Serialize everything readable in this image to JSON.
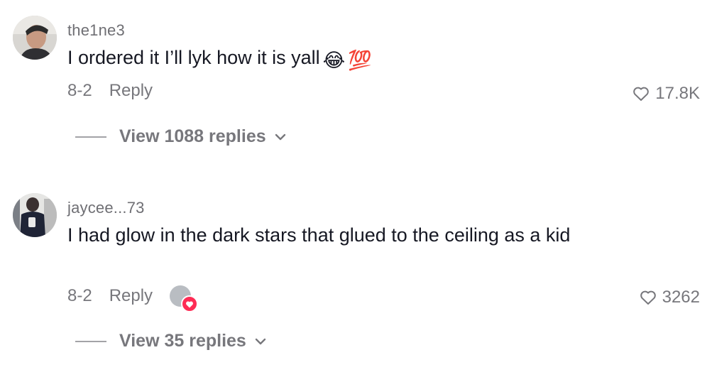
{
  "comments": [
    {
      "username": "the1ne3",
      "text": "I ordered it I’ll lyk how it is yall",
      "emojis": [
        "😂",
        "💯"
      ],
      "date": "8-2",
      "reply_label": "Reply",
      "likes": "17.8K",
      "view_replies": "View 1088 replies"
    },
    {
      "username": "jaycee...73",
      "text": "I had glow in the dark stars that glued to the ceiling as a kid",
      "date": "8-2",
      "reply_label": "Reply",
      "likes": "3262",
      "view_replies": "View 35 replies"
    }
  ],
  "colors": {
    "text_primary": "#161823",
    "text_secondary": "#77777c",
    "username": "#6f6f74",
    "heart_badge": "#fe2c55"
  },
  "icons": [
    "heart-outline-icon",
    "chevron-down-icon",
    "creator-liked-heart-icon"
  ]
}
